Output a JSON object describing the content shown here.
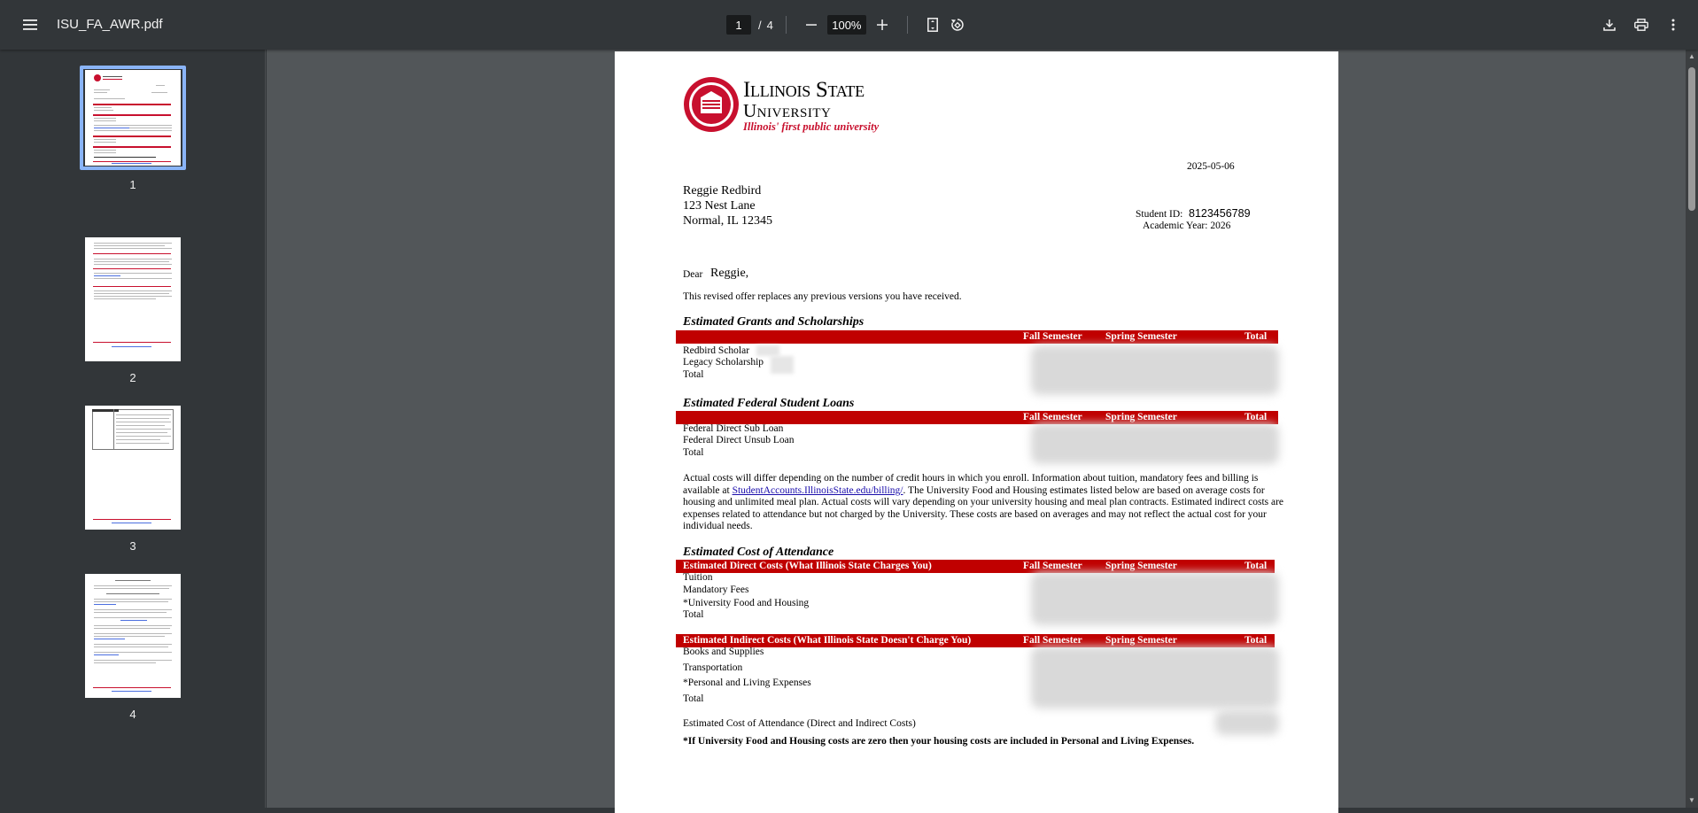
{
  "toolbar": {
    "file_name": "ISU_FA_AWR.pdf",
    "current_page": "1",
    "page_separator": "/",
    "total_pages": "4",
    "zoom": "100%"
  },
  "thumbnails": [
    {
      "label": "1"
    },
    {
      "label": "2"
    },
    {
      "label": "3"
    },
    {
      "label": "4"
    }
  ],
  "document": {
    "logo": {
      "line1": "Illinois State",
      "line2": "University",
      "tagline": "Illinois' first public university"
    },
    "date": "2025-05-06",
    "address": {
      "name": "Reggie Redbird",
      "street": "123 Nest Lane",
      "city": "Normal, IL 12345"
    },
    "student_id_label": "Student ID:",
    "student_id": "8123456789",
    "academic_year": "Academic Year: 2026",
    "dear": "Dear",
    "dear_name": "Reggie,",
    "intro": "This revised offer replaces any previous versions you have received.",
    "col_fall": "Fall Semester",
    "col_spring": "Spring Semester",
    "col_total": "Total",
    "grants": {
      "title": "Estimated Grants and Scholarships",
      "rows": [
        "Redbird Scholar",
        "Legacy Scholarship",
        "Total"
      ]
    },
    "loans": {
      "title": "Estimated Federal Student Loans",
      "rows": [
        "Federal Direct Sub Loan",
        "Federal Direct Unsub Loan",
        "Total"
      ]
    },
    "paragraph": {
      "part1": "Actual costs will differ depending on the number of credit hours in which you enroll.  Information about tuition, mandatory fees and billing is available at ",
      "link": "StudentAccounts.IllinoisState.edu/billing/",
      "part2": ". The University Food and Housing estimates listed below are based on average costs for housing and unlimited meal plan.  Actual costs will vary depending on your university housing and meal plan contracts. Estimated indirect costs are expenses related to attendance but not charged by the University.  These costs are based on averages and may not reflect the actual cost for your individual needs."
    },
    "coa": {
      "title": "Estimated Cost of Attendance",
      "direct_header": "Estimated Direct Costs (What Illinois State Charges You)",
      "direct_rows": [
        "Tuition",
        "Mandatory Fees",
        "*University Food and Housing",
        "Total"
      ],
      "indirect_header": "Estimated Indirect Costs (What Illinois State Doesn't Charge You)",
      "indirect_rows": [
        "Books and Supplies",
        "Transportation",
        "*Personal and Living Expenses",
        "Total"
      ],
      "coa_total": "Estimated Cost of Attendance (Direct and Indirect Costs)"
    },
    "footnote": "*If University Food and Housing costs are zero then your housing costs are included in Personal and Living Expenses."
  }
}
